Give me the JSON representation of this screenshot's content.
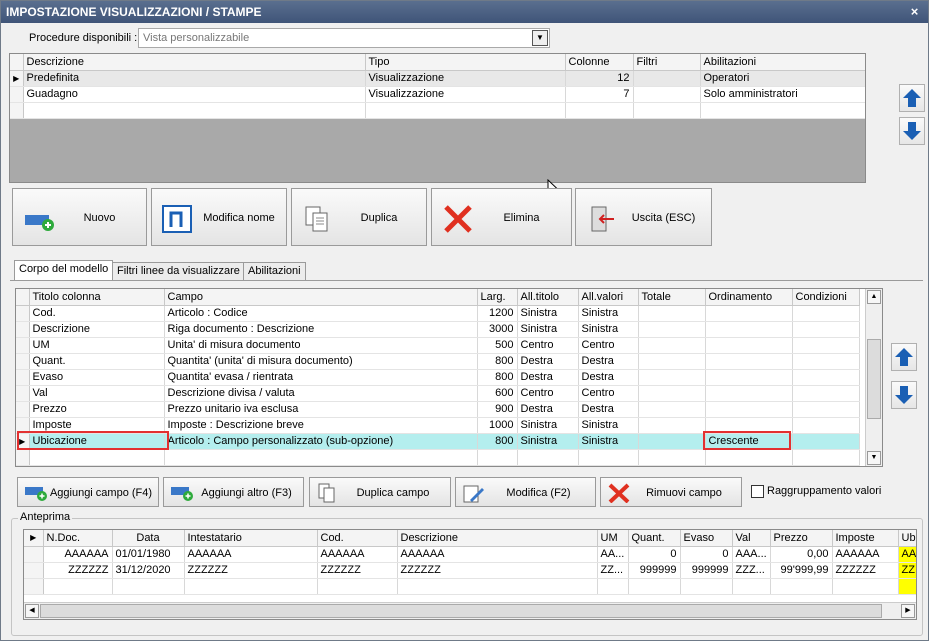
{
  "window": {
    "title": "IMPOSTAZIONE VISUALIZZAZIONI / STAMPE",
    "close": "×"
  },
  "procedure": {
    "label": "Procedure disponibili :",
    "value": "Vista personalizzabile"
  },
  "views_grid": {
    "columns": [
      "Descrizione",
      "Tipo",
      "Colonne",
      "Filtri",
      "Abilitazioni"
    ],
    "rows": [
      [
        "Predefinita",
        "Visualizzazione",
        "12",
        "",
        "Operatori"
      ],
      [
        "Guadagno",
        "Visualizzazione",
        "7",
        "",
        "Solo amministratori"
      ]
    ]
  },
  "toolbar": {
    "nuovo": "Nuovo",
    "modifica_nome": "Modifica nome",
    "duplica": "Duplica",
    "elimina": "Elimina",
    "uscita": "Uscita (ESC)"
  },
  "tabs": [
    "Corpo del modello",
    "Filtri linee da visualizzare",
    "Abilitazioni"
  ],
  "columns_grid": {
    "columns": [
      "Titolo colonna",
      "Campo",
      "Larg.",
      "All.titolo",
      "All.valori",
      "Totale",
      "Ordinamento",
      "Condizioni"
    ],
    "rows": [
      [
        "Cod.",
        "Articolo : Codice",
        "1200",
        "Sinistra",
        "Sinistra",
        "",
        "",
        ""
      ],
      [
        "Descrizione",
        "Riga documento : Descrizione",
        "3000",
        "Sinistra",
        "Sinistra",
        "",
        "",
        ""
      ],
      [
        "UM",
        "Unita' di misura documento",
        "500",
        "Centro",
        "Centro",
        "",
        "",
        ""
      ],
      [
        "Quant.",
        "Quantita' (unita' di misura documento)",
        "800",
        "Destra",
        "Destra",
        "",
        "",
        ""
      ],
      [
        "Evaso",
        "Quantita' evasa / rientrata",
        "800",
        "Destra",
        "Destra",
        "",
        "",
        ""
      ],
      [
        "Val",
        "Descrizione divisa / valuta",
        "600",
        "Centro",
        "Centro",
        "",
        "",
        ""
      ],
      [
        "Prezzo",
        "Prezzo unitario iva esclusa",
        "900",
        "Destra",
        "Destra",
        "",
        "",
        ""
      ],
      [
        "Imposte",
        "Imposte : Descrizione breve",
        "1000",
        "Sinistra",
        "Sinistra",
        "",
        "",
        ""
      ],
      [
        "Ubicazione",
        "Articolo : Campo personalizzato (sub-opzione)",
        "800",
        "Sinistra",
        "Sinistra",
        "",
        "Crescente",
        ""
      ]
    ]
  },
  "actions": {
    "aggiungi_campo": "Aggiungi campo (F4)",
    "aggiungi_altro": "Aggiungi altro (F3)",
    "duplica_campo": "Duplica campo",
    "modifica": "Modifica (F2)",
    "rimuovi_campo": "Rimuovi campo",
    "raggruppamento": "Raggruppamento valori"
  },
  "preview": {
    "legend": "Anteprima",
    "columns": [
      "N.Doc.",
      "Data",
      "Intestatario",
      "Cod.",
      "Descrizione",
      "UM",
      "Quant.",
      "Evaso",
      "Val",
      "Prezzo",
      "Imposte",
      "Ub"
    ],
    "rows": [
      [
        "AAAAAA",
        "01/01/1980",
        "AAAAAA",
        "AAAAAA",
        "AAAAAA",
        "AA...",
        "0",
        "0",
        "AAA...",
        "0,00",
        "AAAAAA",
        "AA"
      ],
      [
        "ZZZZZZ",
        "31/12/2020",
        "ZZZZZZ",
        "ZZZZZZ",
        "ZZZZZZ",
        "ZZ...",
        "999999",
        "999999",
        "ZZZ...",
        "99'999,99",
        "ZZZZZZ",
        "ZZ"
      ]
    ]
  }
}
